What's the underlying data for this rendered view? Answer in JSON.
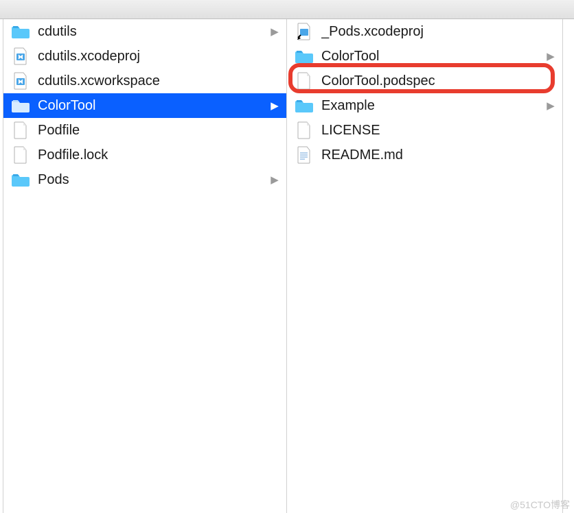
{
  "watermark": "@51CTO博客",
  "left_column": {
    "items": [
      {
        "name": "cdutils",
        "type": "folder",
        "has_children": true,
        "selected": false
      },
      {
        "name": "cdutils.xcodeproj",
        "type": "xcodeproj",
        "has_children": false,
        "selected": false
      },
      {
        "name": "cdutils.xcworkspace",
        "type": "xcodeproj",
        "has_children": false,
        "selected": false
      },
      {
        "name": "ColorTool",
        "type": "folder",
        "has_children": true,
        "selected": true
      },
      {
        "name": "Podfile",
        "type": "file",
        "has_children": false,
        "selected": false
      },
      {
        "name": "Podfile.lock",
        "type": "file",
        "has_children": false,
        "selected": false
      },
      {
        "name": "Pods",
        "type": "folder",
        "has_children": true,
        "selected": false
      }
    ]
  },
  "right_column": {
    "items": [
      {
        "name": "_Pods.xcodeproj",
        "type": "xcodeproj-alias",
        "has_children": false,
        "highlighted": false
      },
      {
        "name": "ColorTool",
        "type": "folder",
        "has_children": true,
        "highlighted": false
      },
      {
        "name": "ColorTool.podspec",
        "type": "file",
        "has_children": false,
        "highlighted": true
      },
      {
        "name": "Example",
        "type": "folder",
        "has_children": true,
        "highlighted": false
      },
      {
        "name": "LICENSE",
        "type": "file",
        "has_children": false,
        "highlighted": false
      },
      {
        "name": "README.md",
        "type": "md",
        "has_children": false,
        "highlighted": false
      }
    ]
  },
  "highlight": {
    "color": "#e83c2e"
  }
}
